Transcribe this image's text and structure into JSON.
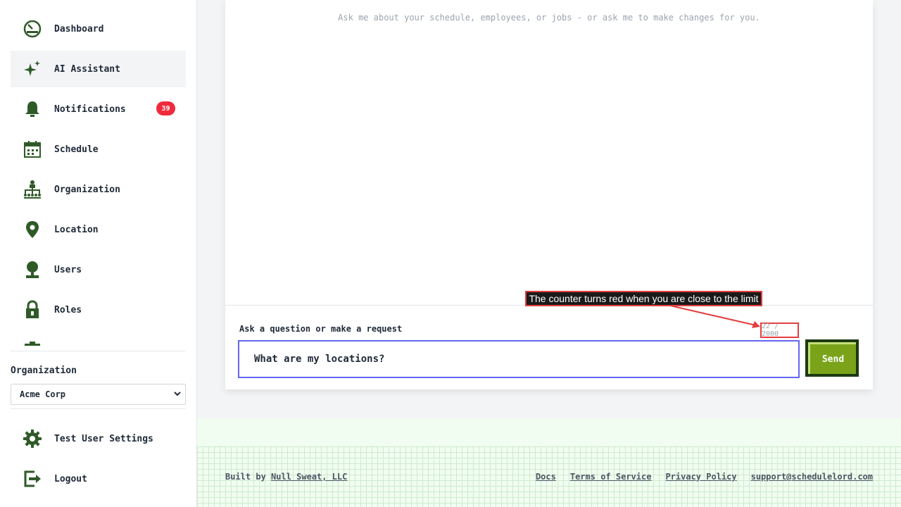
{
  "sidebar": {
    "nav": [
      {
        "label": "Dashboard",
        "icon": "dashboard-icon"
      },
      {
        "label": "AI Assistant",
        "icon": "sparkle-icon",
        "active": true
      },
      {
        "label": "Notifications",
        "icon": "bell-icon",
        "badge": "39"
      },
      {
        "label": "Schedule",
        "icon": "calendar-icon"
      },
      {
        "label": "Organization",
        "icon": "org-chart-icon"
      },
      {
        "label": "Location",
        "icon": "map-pin-icon"
      },
      {
        "label": "Users",
        "icon": "user-icon"
      },
      {
        "label": "Roles",
        "icon": "lock-icon"
      }
    ],
    "org_label": "Organization",
    "org_selected": "Acme Corp",
    "bottom": {
      "settings_label": "Test User Settings",
      "logout_label": "Logout"
    }
  },
  "chat": {
    "hint": "Ask me about your schedule, employees, or jobs - or ask me to make changes for you.",
    "composer_label": "Ask a question or make a request",
    "counter": "22 / 2000",
    "input_value": "What are my locations?",
    "send_label": "Send"
  },
  "callout": {
    "text": "The counter turns red when you are close to the limit"
  },
  "footer": {
    "built_by_prefix": "Built by",
    "built_by_link": "Null Sweat, LLC",
    "links": [
      "Docs",
      "Terms of Service",
      "Privacy Policy",
      "support@schedulelord.com"
    ]
  },
  "colors": {
    "icon_green": "#2f5a28",
    "send_green": "#7aa31a",
    "badge_red": "#ef2a3c",
    "input_border": "#6366f1",
    "counter_border": "#e53e3e"
  }
}
